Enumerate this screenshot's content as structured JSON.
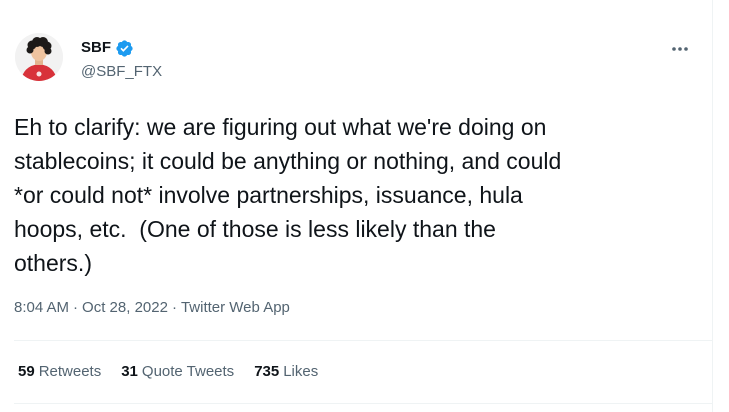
{
  "author": {
    "display_name": "SBF",
    "handle": "@SBF_FTX",
    "verified": true
  },
  "tweet": {
    "text": "Eh to clarify: we are figuring out what we're doing on\nstablecoins; it could be anything or nothing, and could\n*or could not* involve partnerships, issuance, hula\nhoops, etc.  (One of those is less likely than the\nothers.)"
  },
  "meta": {
    "time": "8:04 AM",
    "separator": "·",
    "date": "Oct 28, 2022",
    "source": "Twitter Web App"
  },
  "stats": {
    "retweets": {
      "count": "59",
      "label": "Retweets"
    },
    "quote_tweets": {
      "count": "31",
      "label": "Quote Tweets"
    },
    "likes": {
      "count": "735",
      "label": "Likes"
    }
  },
  "icons": {
    "verified": "verified-badge-icon",
    "more": "more-options-icon"
  },
  "colors": {
    "verified_blue": "#1d9bf0",
    "secondary_text": "#536471",
    "divider": "#eff3f4",
    "shirt_red": "#d8323a"
  }
}
